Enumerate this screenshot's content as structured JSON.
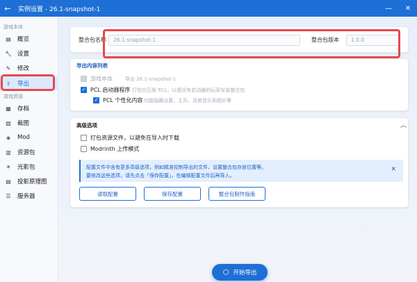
{
  "window": {
    "title": "实例设置 - 26.1-snapshot-1",
    "back_icon": "←",
    "minimize_icon": "—",
    "close_icon": "✕"
  },
  "sidebar": {
    "section1": "游戏本体",
    "section2": "游戏资源",
    "items": [
      {
        "label": "概览",
        "icon": "▤"
      },
      {
        "label": "设置",
        "icon": "🔧"
      },
      {
        "label": "修改",
        "icon": "✎"
      },
      {
        "label": "导出",
        "icon": "⇪"
      },
      {
        "label": "存档",
        "icon": "▦"
      },
      {
        "label": "截图",
        "icon": "▨"
      },
      {
        "label": "Mod",
        "icon": "◈"
      },
      {
        "label": "资源包",
        "icon": "▥"
      },
      {
        "label": "光影包",
        "icon": "☀"
      },
      {
        "label": "投影原理图",
        "icon": "▤"
      },
      {
        "label": "服务器",
        "icon": "☰"
      }
    ]
  },
  "pack": {
    "name_label": "整合包名称",
    "name_value": "26.1-snapshot-1",
    "version_label": "整合包版本",
    "version_value": "1.0.0"
  },
  "export_list": {
    "title": "导出内容列表",
    "items": [
      {
        "label": "游戏本体",
        "desc": "导出 26.1-snapshot-1",
        "checked": true,
        "disabled": true
      },
      {
        "label": "PCL 启动器程序",
        "desc": "打包社区版 PCL，以便没有启动器的玩家安装整合包",
        "checked": true,
        "disabled": false
      },
      {
        "label": "PCL 个性化内容",
        "desc": "功能隐藏设置、主页、背景音乐和图片等",
        "checked": true,
        "disabled": false
      }
    ]
  },
  "advanced": {
    "title": "高级选项",
    "collapse_icon": "︿",
    "options": [
      {
        "label": "打包资源文件，以避免在导入时下载",
        "checked": false
      },
      {
        "label": "Modrinth 上传模式",
        "checked": false
      }
    ],
    "info_line1": "配置文件中含有更多高级选项，例如精准控制导出的文件、设置整合包存放位置等。",
    "info_line2": "要修改这些选项，请先点击「保存配置」，在编辑配置文件后再导入。",
    "info_close": "✕",
    "buttons": [
      "读取配置",
      "保存配置",
      "整合包制作指南"
    ]
  },
  "start_button": {
    "label": "开始导出",
    "icon": "⬡"
  },
  "colors": {
    "accent": "#1e6fd6",
    "highlight": "#e5484d"
  }
}
